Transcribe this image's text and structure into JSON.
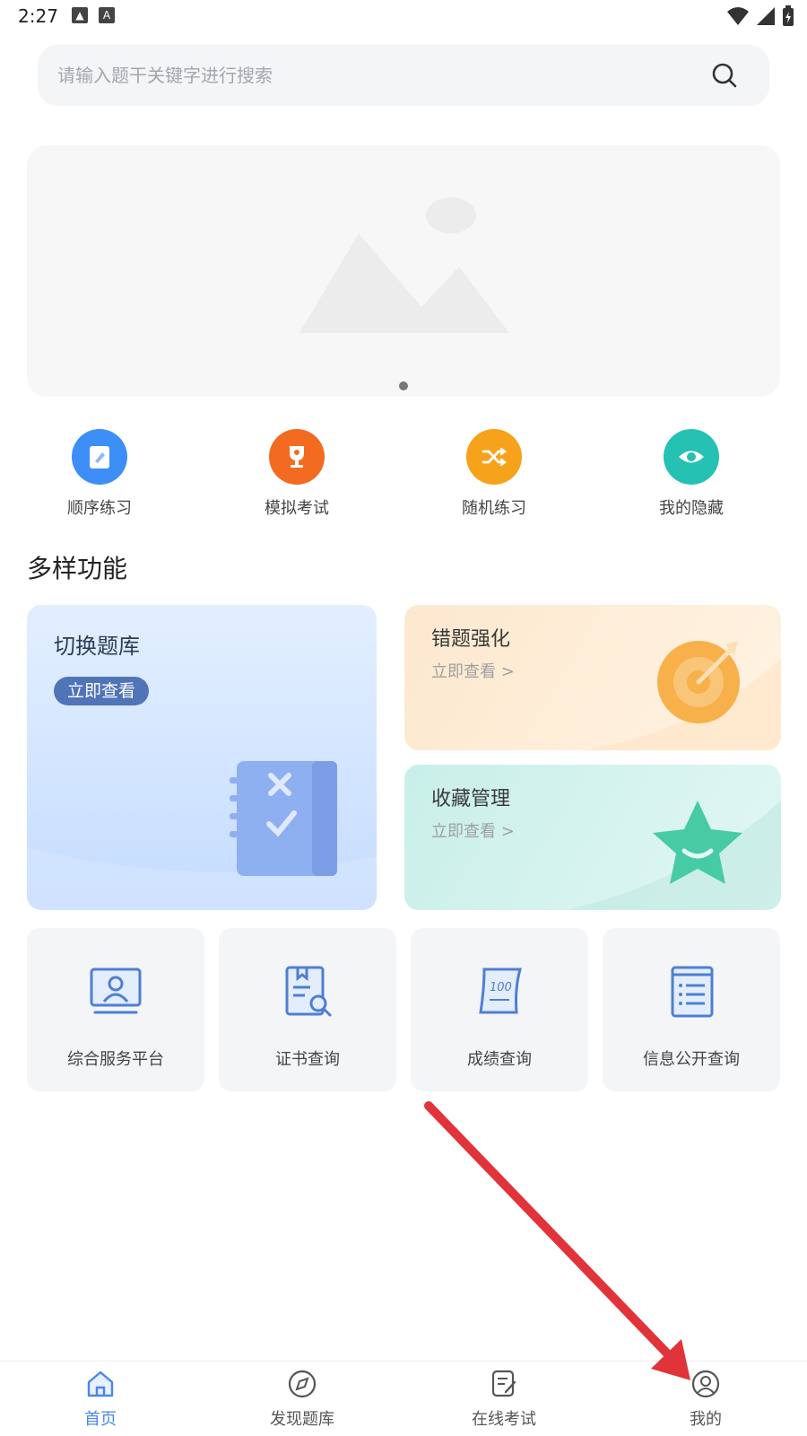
{
  "status_bar": {
    "time": "2:27"
  },
  "search": {
    "placeholder": "请输入题干关键字进行搜索"
  },
  "quick_actions": [
    {
      "label": "顺序练习",
      "icon": "notebook-pencil-icon",
      "color": "#3d8ef7"
    },
    {
      "label": "模拟考试",
      "icon": "trophy-icon",
      "color": "#f26b21"
    },
    {
      "label": "随机练习",
      "icon": "shuffle-icon",
      "color": "#f7a21b"
    },
    {
      "label": "我的隐藏",
      "icon": "eye-icon",
      "color": "#25c1b2"
    }
  ],
  "section": {
    "title": "多样功能"
  },
  "cards": {
    "switch": {
      "title": "切换题库",
      "badge": "立即查看"
    },
    "wrong": {
      "title": "错题强化",
      "sub": "立即查看 >"
    },
    "favorites": {
      "title": "收藏管理",
      "sub": "立即查看 >"
    }
  },
  "tiles": [
    {
      "label": "综合服务平台",
      "icon": "monitor-user-icon"
    },
    {
      "label": "证书查询",
      "icon": "certificate-search-icon"
    },
    {
      "label": "成绩查询",
      "icon": "score-scroll-icon"
    },
    {
      "label": "信息公开查询",
      "icon": "document-list-icon"
    }
  ],
  "bottom_nav": [
    {
      "label": "首页",
      "icon": "home-icon",
      "active": true
    },
    {
      "label": "发现题库",
      "icon": "compass-icon",
      "active": false
    },
    {
      "label": "在线考试",
      "icon": "exam-edit-icon",
      "active": false
    },
    {
      "label": "我的",
      "icon": "user-circle-icon",
      "active": false
    }
  ],
  "colors": {
    "accent": "#4a86e8",
    "annotation_arrow": "#e0343a"
  }
}
